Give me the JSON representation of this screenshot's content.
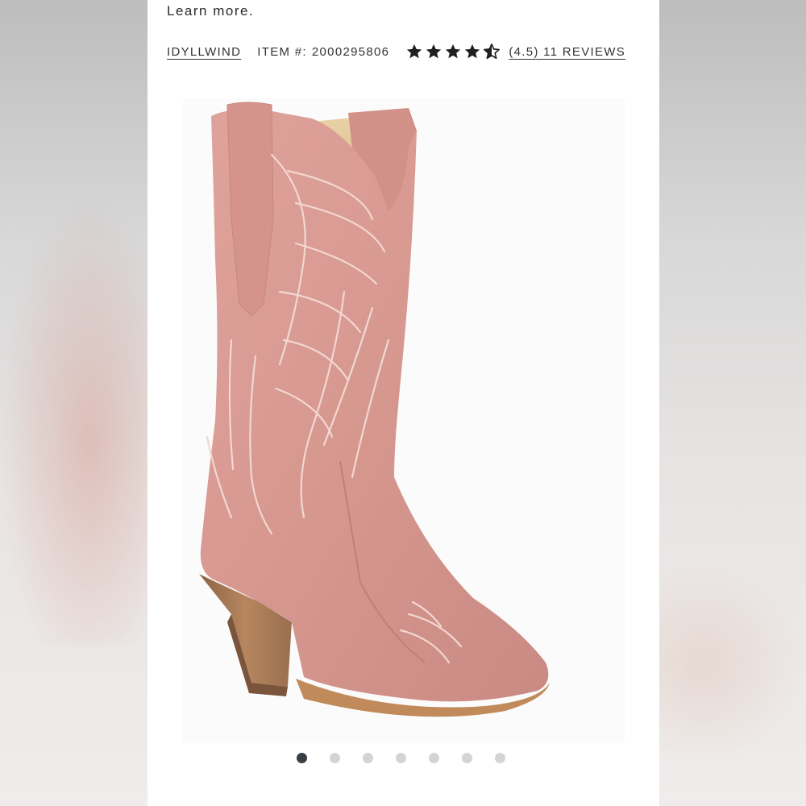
{
  "intro": {
    "text": "Learn more."
  },
  "product": {
    "brand": "IDYLLWIND",
    "item_label": "ITEM #:",
    "item_number": "2000295806",
    "rating": 4.5,
    "reviews_text": "(4.5) 11 REVIEWS",
    "stars_full": 4,
    "stars_half": 1
  },
  "image": {
    "subject": "boot-photo",
    "alt": ""
  },
  "carousel": {
    "count": 7,
    "active_index": 0
  },
  "colors": {
    "text": "#333333",
    "boot": "#d89a92",
    "heel": "#a97a57",
    "dot_active": "#3a3e46",
    "dot_inactive": "#d4d4d4"
  }
}
